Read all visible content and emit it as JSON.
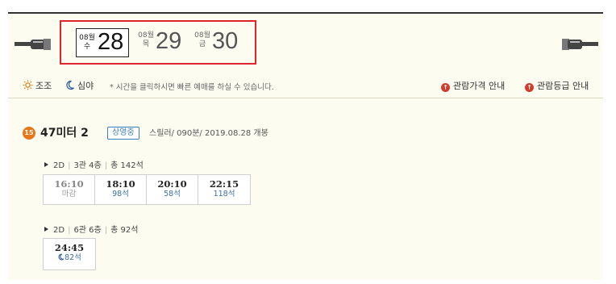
{
  "dates": [
    {
      "month": "08월",
      "weekday": "수",
      "day": "28",
      "selected": true
    },
    {
      "month": "08월",
      "weekday": "목",
      "day": "29",
      "selected": false
    },
    {
      "month": "08월",
      "weekday": "금",
      "day": "30",
      "selected": false
    }
  ],
  "filters": {
    "morning": "조조",
    "night": "심야",
    "notice": "* 시간을 클릭하시면 빠른 예매를 하실 수 있습니다.",
    "price_info": "관람가격 안내",
    "rating_info": "관람등급 안내"
  },
  "movie": {
    "age": "15",
    "title": "47미터 2",
    "status": "상영중",
    "meta": "스릴러/ 090분/ 2019.08.28 개봉",
    "halls": [
      {
        "format": "2D",
        "hall": "3관 4층",
        "total": "총 142석",
        "times": [
          {
            "time": "16:10",
            "seats": "마감",
            "closed": true
          },
          {
            "time": "18:10",
            "seats": "98석",
            "closed": false
          },
          {
            "time": "20:10",
            "seats": "58석",
            "closed": false
          },
          {
            "time": "22:15",
            "seats": "118석",
            "closed": false
          }
        ]
      },
      {
        "format": "2D",
        "hall": "6관 6층",
        "total": "총 92석",
        "times": [
          {
            "time": "24:45",
            "seats": "82석",
            "closed": false,
            "night": true
          }
        ]
      }
    ]
  },
  "colors": {
    "accent_red": "#e0242e",
    "seat_blue": "#3d6fa5",
    "age_orange": "#e77718",
    "panel_bg": "#fdfcf0"
  },
  "icons": [
    "pointing-hand-left-icon",
    "pointing-hand-right-icon",
    "sun-icon",
    "moon-icon",
    "info-icon"
  ]
}
